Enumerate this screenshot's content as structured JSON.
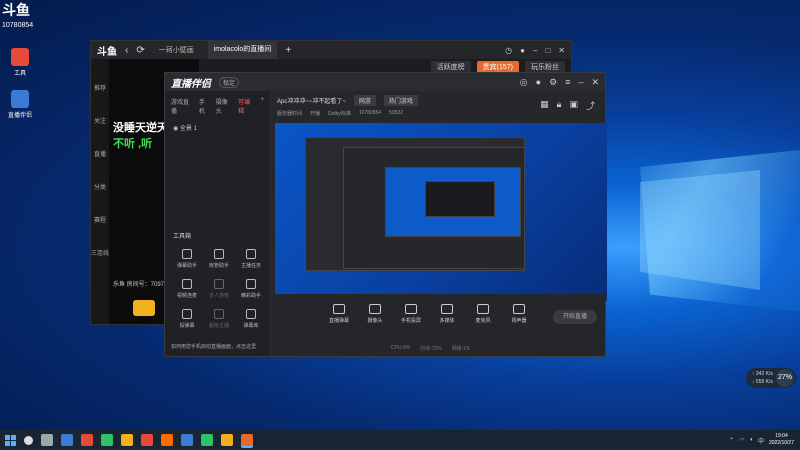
{
  "desktop": {
    "logo": "斗鱼",
    "user_id": "10780854",
    "icons": [
      {
        "label": "工具",
        "color": "#e84a3a"
      },
      {
        "label": "直播伴侣",
        "color": "#3a7bd5"
      }
    ]
  },
  "window_douyu": {
    "brand": "斗鱼",
    "tabs": [
      "一珂小壁画",
      "imolacolo的直播间"
    ],
    "side_items": [
      "推荐",
      "关注",
      "直播",
      "分类",
      "赛程",
      "三连线"
    ],
    "chat_lines": [
      "没睡天逆天",
      "不听 ,听"
    ],
    "topstrip": [
      "活跃度榜",
      "贵宾(157)",
      "玩乐粉丝"
    ],
    "room_id": "乐鱼 房间号：70971",
    "follow_label": "关注"
  },
  "window_companion": {
    "brand": "直播伴侣",
    "version": "稳定",
    "left_tabs": [
      "游戏直播",
      "手机",
      "摄像头",
      "可编辑",
      "模板"
    ],
    "scene_label": "全景 1",
    "tools_header": "工具箱",
    "tools": [
      {
        "label": "弹幕助手",
        "dim": false
      },
      {
        "label": "房管助手",
        "dim": false
      },
      {
        "label": "主播任务",
        "dim": false
      },
      {
        "label": "视频连麦",
        "dim": false
      },
      {
        "label": "多人连麦",
        "dim": true
      },
      {
        "label": "精彩助手",
        "dim": false
      },
      {
        "label": "投弹幕",
        "dim": false
      },
      {
        "label": "超级主播",
        "dim": true
      },
      {
        "label": "弹幕库",
        "dim": false
      }
    ],
    "notice": "如何用您手机启动直播画面，点击这里",
    "stream_title": "Apc冲冲冲~~冲不起看了~",
    "room_badge": "网游",
    "hot_label": "热门游戏",
    "info_row": [
      "服务器时间",
      "开播",
      "Dolby标准",
      "10780854",
      "59532"
    ],
    "controls": [
      "直播弹幕",
      "摄像头",
      "手机投屏",
      "多媒体",
      "麦克风",
      "扬声器"
    ],
    "start_button": "开始直播",
    "stats": [
      "CPU:9%",
      "内存:72%",
      "网络:1%"
    ]
  },
  "widget": {
    "up": "↑ 242 K/s",
    "down": "↓ 555 K/s",
    "percent": "27%"
  },
  "taskbar": {
    "time": "19:04",
    "date": "2022/10/27",
    "icon_colors": [
      "#e84a3a",
      "#3a7bd5",
      "#2fc26b",
      "#f2b01e",
      "#e84a3a",
      "#ff6a00",
      "#3a7bd5",
      "#2fc26b",
      "#f2b01e",
      "#e56a2b"
    ]
  }
}
